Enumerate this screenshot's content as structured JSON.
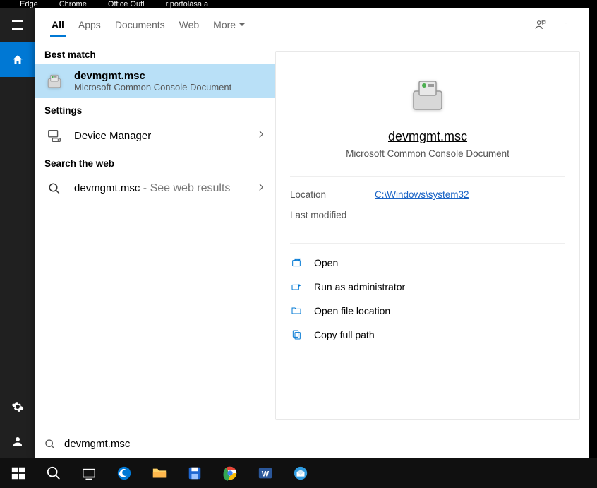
{
  "desktop": {
    "icons": [
      "Edge",
      "Chrome",
      "Office Outl",
      "riportolása a"
    ]
  },
  "tabs": {
    "all": "All",
    "apps": "Apps",
    "documents": "Documents",
    "web": "Web",
    "more": "More"
  },
  "sections": {
    "best_match": "Best match",
    "settings": "Settings",
    "search_web": "Search the web"
  },
  "best_match": {
    "title": "devmgmt.msc",
    "subtitle": "Microsoft Common Console Document"
  },
  "settings_result": {
    "title": "Device Manager"
  },
  "web_result": {
    "title": "devmgmt.msc",
    "suffix": " - See web results"
  },
  "detail": {
    "title": "devmgmt.msc",
    "subtitle": "Microsoft Common Console Document",
    "location_label": "Location",
    "location_value": "C:\\Windows\\system32",
    "modified_label": "Last modified",
    "modified_value": ""
  },
  "actions": {
    "open": "Open",
    "runas": "Run as administrator",
    "openloc": "Open file location",
    "copypath": "Copy full path"
  },
  "search": {
    "value": "devmgmt.msc"
  }
}
